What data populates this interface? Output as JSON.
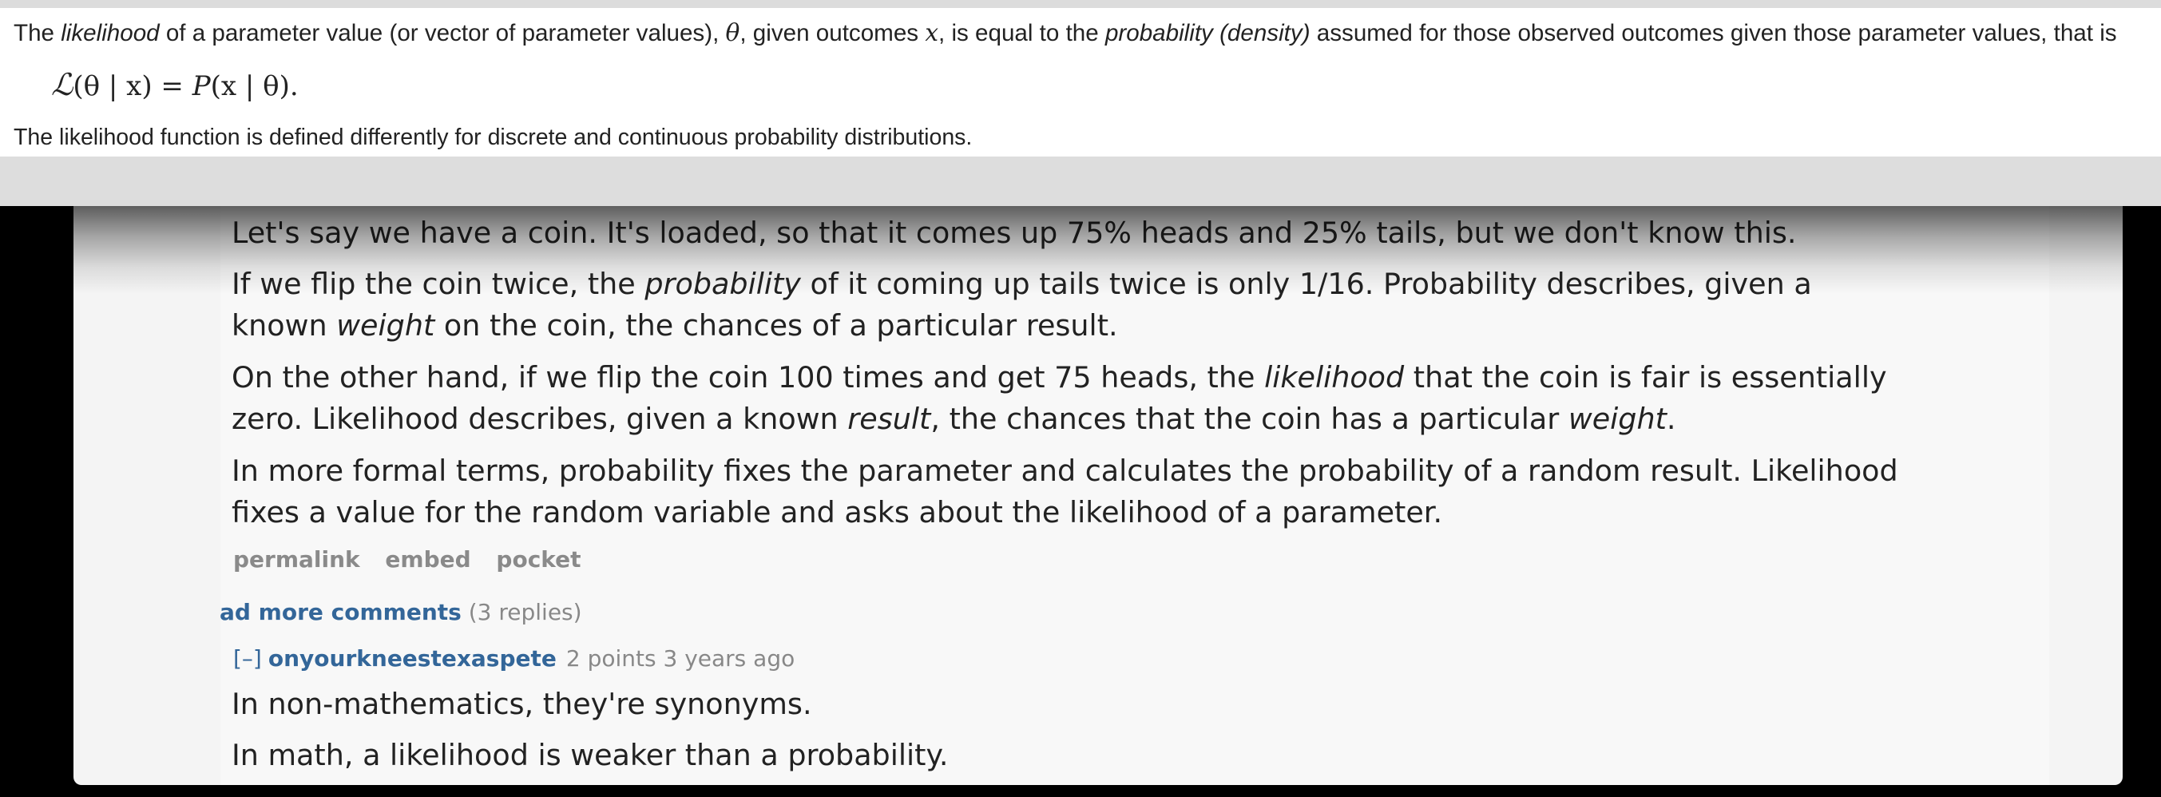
{
  "wiki": {
    "para1": {
      "t1": "The ",
      "i1": "likelihood",
      "t2": " of a parameter value (or vector of parameter values), ",
      "m1": "θ",
      "t3": ", given outcomes ",
      "m2": "x",
      "t4": ", is equal to the ",
      "i2": "probability (density)",
      "t5": " assumed for those observed outcomes given those parameter values, that is"
    },
    "formula": {
      "lhs": "ℒ",
      "mid": "(θ | x) = ",
      "rhs": "P",
      "end": "(x | θ)."
    },
    "para2": "The likelihood function is defined differently for discrete and continuous probability distributions."
  },
  "comment1": {
    "p1": "Let's say we have a coin. It's loaded, so that it comes up 75% heads and 25% tails, but we don't know this.",
    "p2_a": "If we flip the coin twice, the ",
    "p2_b": "probability",
    "p2_c": " of it coming up tails twice is only 1/16. Probability describes, given a",
    "p2_d": "known ",
    "p2_e": "weight",
    "p2_f": " on the coin, the chances of a particular result.",
    "p3_a": "On the other hand, if we flip the coin 100 times and get 75 heads, the ",
    "p3_b": "likelihood",
    "p3_c": " that the coin is fair is essentially",
    "p3_d": "zero. Likelihood describes, given a known ",
    "p3_e": "result",
    "p3_f": ", the chances that the coin has a particular ",
    "p3_g": "weight",
    "p3_h": ".",
    "p4_l1": "In more formal terms, probability fixes the parameter and calculates the probability of a random result. Likelihood",
    "p4_l2": "fixes a value for the random variable and asks about the likelihood of a parameter.",
    "links": [
      "permalink",
      "embed",
      "pocket"
    ]
  },
  "more_comments": {
    "link": "ad more comments",
    "count": "(3 replies)"
  },
  "comment2": {
    "collapse": "[–]",
    "author": "onyourkneestexaspete",
    "meta": "2 points 3 years ago",
    "line1": "In non-mathematics, they're synonyms.",
    "line2": "In math, a likelihood is weaker than a probability."
  }
}
